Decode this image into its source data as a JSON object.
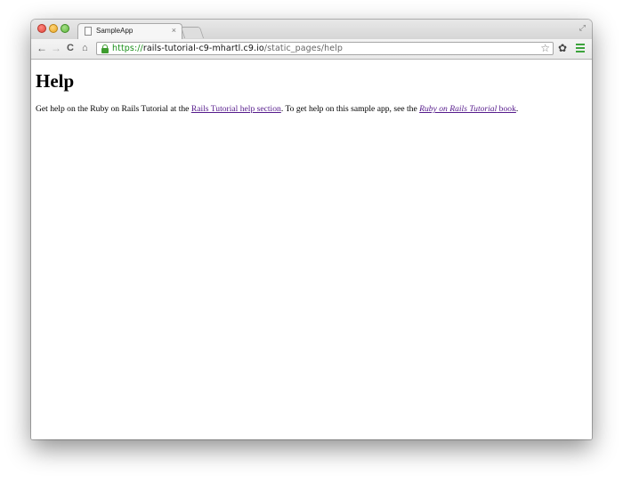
{
  "browser": {
    "tab": {
      "title": "SampleApp",
      "close_label": "×"
    },
    "toolbar": {
      "back_label": "←",
      "forward_label": "→",
      "reload_label": "C",
      "home_label": "⌂",
      "star_label": "☆",
      "settings_label": "✿"
    },
    "url": {
      "scheme": "https://",
      "host": "rails-tutorial-c9-mhartl.c9.io",
      "path": "/static_pages/help"
    },
    "icons": [
      "page-icon",
      "close-icon",
      "fullscreen-icon",
      "back-icon",
      "forward-icon",
      "reload-icon",
      "home-icon",
      "lock-icon",
      "star-icon",
      "gear-icon",
      "menu-icon"
    ],
    "colors": {
      "secure": "#3e9c2f",
      "visited_link": "#551a8b"
    }
  },
  "page": {
    "heading": "Help",
    "text_1": "Get help on the Ruby on Rails Tutorial at the ",
    "link_help_section": "Rails Tutorial help section",
    "text_2": ". To get help on this sample app, see the ",
    "link_book_title": "Ruby on Rails Tutorial",
    "link_book_suffix": " book",
    "text_3": "."
  }
}
